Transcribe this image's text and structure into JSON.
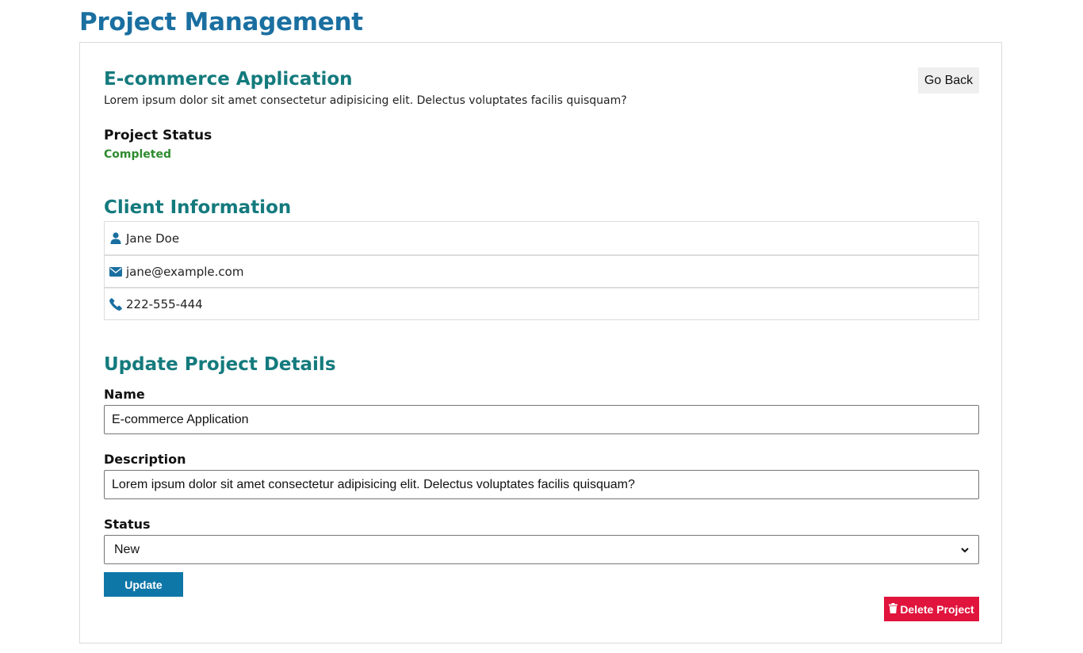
{
  "page": {
    "title": "Project Management"
  },
  "project": {
    "title": "E-commerce Application",
    "description": "Lorem ipsum dolor sit amet consectetur adipisicing elit. Delectus voluptates facilis quisquam?",
    "go_back_label": "Go Back",
    "status_label": "Project Status",
    "status_value": "Completed"
  },
  "client": {
    "heading": "Client Information",
    "items": [
      {
        "icon": "user-icon",
        "value": "Jane Doe"
      },
      {
        "icon": "envelope-icon",
        "value": "jane@example.com"
      },
      {
        "icon": "phone-icon",
        "value": "222-555-444"
      }
    ]
  },
  "update_form": {
    "heading": "Update Project Details",
    "name_label": "Name",
    "name_value": "E-commerce Application",
    "description_label": "Description",
    "description_value": "Lorem ipsum dolor sit amet consectetur adipisicing elit. Delectus voluptates facilis quisquam?",
    "status_label": "Status",
    "status_selected": "New",
    "update_label": "Update",
    "delete_label": "Delete Project"
  },
  "colors": {
    "title_blue": "#1a6fa0",
    "heading_teal": "#147a7d",
    "status_green": "#2e8b2e",
    "update_button": "#0f76a8",
    "delete_button": "#e0143c"
  }
}
